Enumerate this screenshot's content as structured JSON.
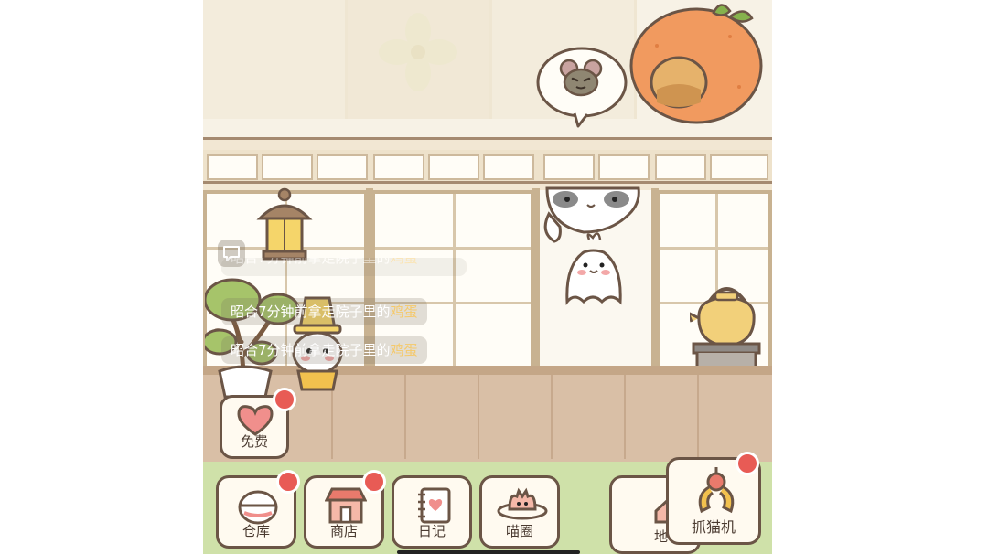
{
  "chat": {
    "line1": "昭合7分钟前拿走院子里的",
    "line1_item": "鸡蛋",
    "line2": "昭合7分钟前拿走院子里的",
    "line2_item": "鸡蛋",
    "highlight_color": "#f5c96b"
  },
  "buttons": {
    "free": {
      "label": "免费",
      "icon": "heart-pouch-icon",
      "has_badge": true
    },
    "storage": {
      "label": "仓库",
      "icon": "basket-icon",
      "has_badge": true
    },
    "shop": {
      "label": "商店",
      "icon": "shop-icon",
      "has_badge": true
    },
    "diary": {
      "label": "日记",
      "icon": "notebook-icon",
      "has_badge": false
    },
    "circle": {
      "label": "喵圈",
      "icon": "cat-planet-icon",
      "has_badge": false
    },
    "claw": {
      "label": "抓猫机",
      "icon": "claw-icon",
      "has_badge": true
    },
    "partial": {
      "label": "地",
      "icon": "house-icon"
    }
  },
  "scene": {
    "thought_bubble_icon": "mouse-icon",
    "badge_color": "#e85b55"
  }
}
